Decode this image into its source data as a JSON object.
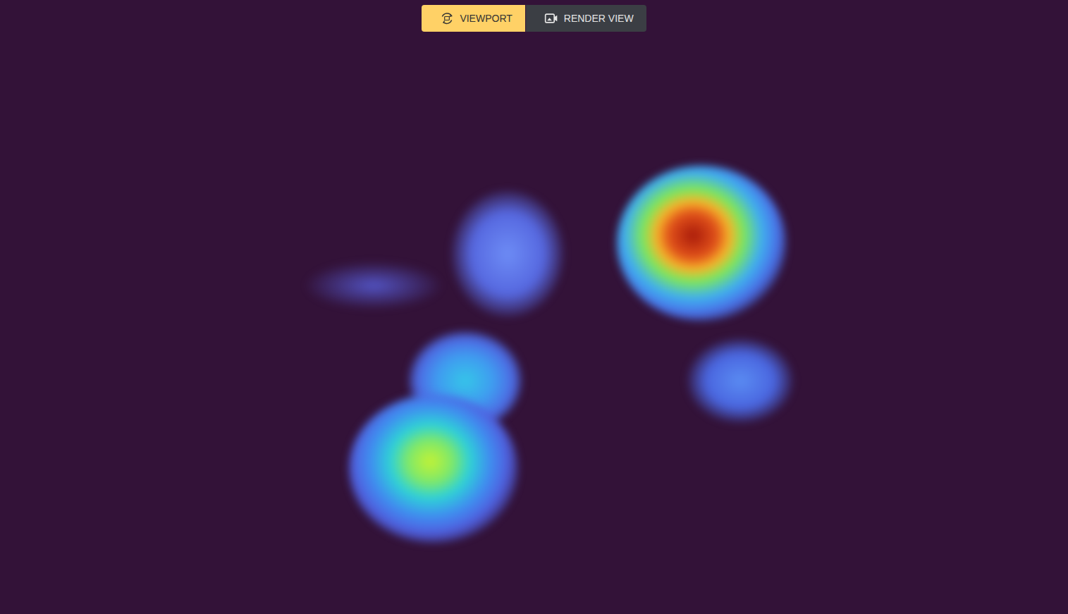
{
  "toolbar": {
    "buttons": [
      {
        "label": "VIEWPORT",
        "kind": "viewport",
        "selected": true
      },
      {
        "label": "RENDER VIEW",
        "kind": "render",
        "selected": false
      }
    ]
  }
}
